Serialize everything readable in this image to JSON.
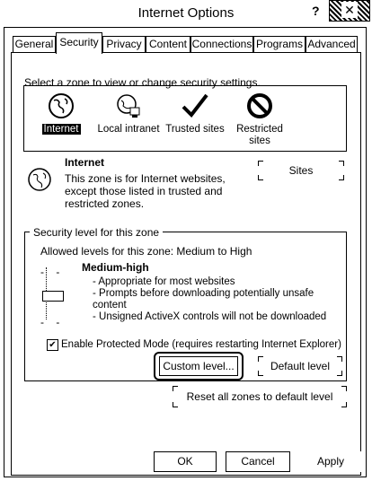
{
  "window": {
    "title": "Internet Options",
    "help": "?",
    "close": "✕"
  },
  "tabs": [
    "General",
    "Security",
    "Privacy",
    "Content",
    "Connections",
    "Programs",
    "Advanced"
  ],
  "active_tab": "Security",
  "zones": {
    "header": "Select a zone to view or change security settings.",
    "items": [
      {
        "label": "Internet",
        "icon": "globe-icon",
        "selected": true
      },
      {
        "label": "Local intranet",
        "icon": "intranet-icon",
        "selected": false
      },
      {
        "label": "Trusted sites",
        "icon": "checkmark-icon",
        "selected": false
      },
      {
        "label": "Restricted sites",
        "icon": "no-entry-icon",
        "selected": false
      }
    ]
  },
  "zone_info": {
    "name": "Internet",
    "description": "This zone is for Internet websites, except those listed in trusted and restricted zones.",
    "sites_button": "Sites"
  },
  "security_level": {
    "group_label": "Security level for this zone",
    "allowed": "Allowed levels for this zone: Medium to High",
    "level_name": "Medium-high",
    "items": [
      "- Appropriate for most websites",
      "- Prompts before downloading potentially unsafe",
      "content",
      "- Unsigned ActiveX controls will not be downloaded"
    ],
    "protected_mode_label": "Enable Protected Mode (requires restarting Internet Explorer)",
    "protected_mode_checked": true,
    "custom_level": "Custom level...",
    "default_level": "Default level"
  },
  "reset_all": "Reset all zones to default level",
  "footer": {
    "ok": "OK",
    "cancel": "Cancel",
    "apply": "Apply"
  }
}
